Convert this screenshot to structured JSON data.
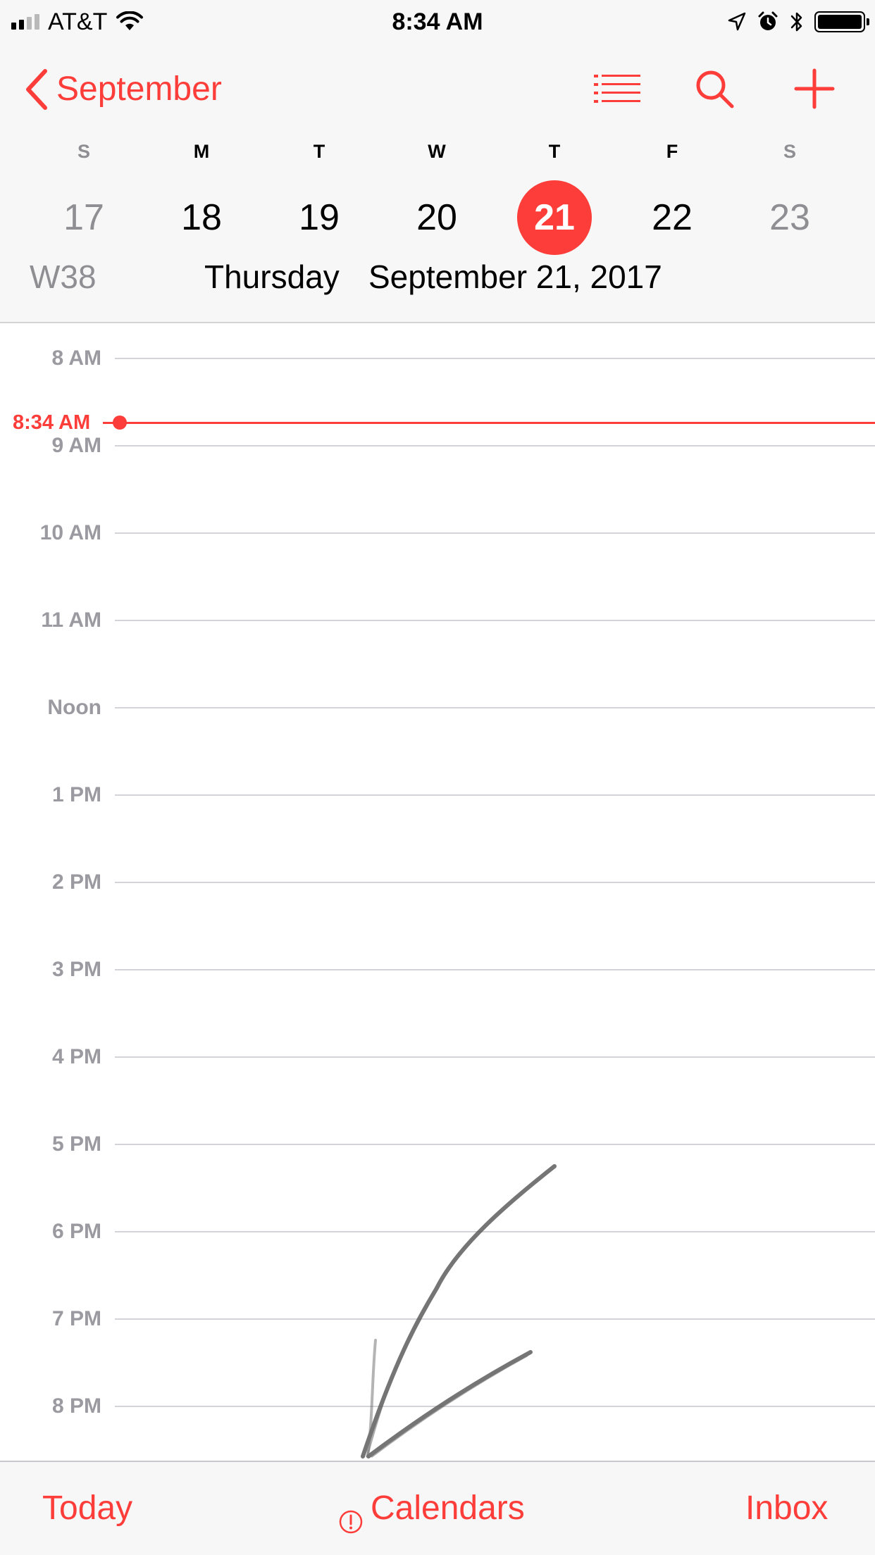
{
  "status_bar": {
    "carrier": "AT&T",
    "time": "8:34 AM",
    "signal_bars": 4,
    "signal_bars_filled": 2,
    "icons": [
      "signal-icon",
      "wifi-icon",
      "location-icon",
      "alarm-icon",
      "bluetooth-icon",
      "battery-icon"
    ]
  },
  "nav": {
    "back_label": "September",
    "back_icon": "chevron-left-icon",
    "action_icons": [
      "list-icon",
      "search-icon",
      "add-icon"
    ]
  },
  "week": {
    "weekdays": [
      "S",
      "M",
      "T",
      "W",
      "T",
      "F",
      "S"
    ],
    "dates": [
      "17",
      "18",
      "19",
      "20",
      "21",
      "22",
      "23"
    ],
    "selected_index": 4,
    "week_number": "W38",
    "selected_day_name": "Thursday",
    "selected_full_date": "September 21, 2017"
  },
  "timeline": {
    "hours": [
      "8 AM",
      "9 AM",
      "10 AM",
      "11 AM",
      "Noon",
      "1 PM",
      "2 PM",
      "3 PM",
      "4 PM",
      "5 PM",
      "6 PM",
      "7 PM",
      "8 PM"
    ],
    "current_time_label": "8:34 AM"
  },
  "tab_bar": {
    "today_label": "Today",
    "calendars_label": "Calendars",
    "calendars_icon": "alert-circle-icon",
    "inbox_label": "Inbox"
  },
  "colors": {
    "accent": "#fc3d39",
    "muted_text": "#8e8e93",
    "hour_label": "#9a9aa0",
    "separator": "#d4d4d8",
    "bar_background": "#f7f7f7"
  }
}
